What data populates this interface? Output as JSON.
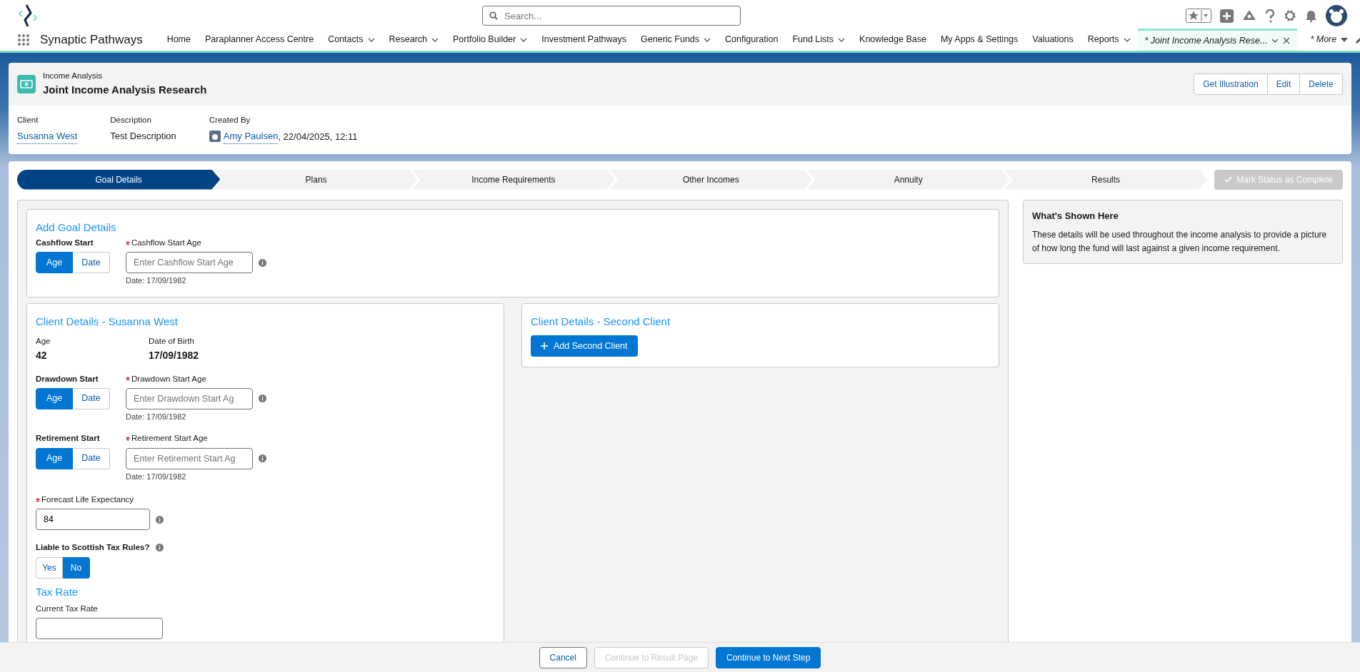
{
  "app": {
    "name": "Synaptic Pathways"
  },
  "search": {
    "placeholder": "Search..."
  },
  "nav_items": [
    {
      "label": "Home",
      "menu": false,
      "closable": false,
      "selected": false
    },
    {
      "label": "Paraplanner Access Centre",
      "menu": false,
      "closable": false,
      "selected": false
    },
    {
      "label": "Contacts",
      "menu": true,
      "closable": false,
      "selected": false
    },
    {
      "label": "Research",
      "menu": true,
      "closable": false,
      "selected": false
    },
    {
      "label": "Portfolio Builder",
      "menu": true,
      "closable": false,
      "selected": false
    },
    {
      "label": "Investment Pathways",
      "menu": false,
      "closable": false,
      "selected": false
    },
    {
      "label": "Generic Funds",
      "menu": true,
      "closable": false,
      "selected": false
    },
    {
      "label": "Configuration",
      "menu": false,
      "closable": false,
      "selected": false
    },
    {
      "label": "Fund Lists",
      "menu": true,
      "closable": false,
      "selected": false
    },
    {
      "label": "Knowledge Base",
      "menu": false,
      "closable": false,
      "selected": false
    },
    {
      "label": "My Apps & Settings",
      "menu": false,
      "closable": false,
      "selected": false
    },
    {
      "label": "Valuations",
      "menu": false,
      "closable": false,
      "selected": false
    },
    {
      "label": "Reports",
      "menu": true,
      "closable": false,
      "selected": false
    },
    {
      "label": "* Joint Income Analysis Rese...",
      "menu": true,
      "closable": true,
      "selected": true
    }
  ],
  "more": "* More",
  "record": {
    "object_type": "Income Analysis",
    "title": "Joint Income Analysis Research",
    "actions": [
      "Get Illustration",
      "Edit",
      "Delete"
    ],
    "fields": [
      {
        "label": "Client",
        "kind": "link",
        "value": "Susanna West"
      },
      {
        "label": "Description",
        "kind": "text",
        "value": "Test Description"
      },
      {
        "label": "Created By",
        "kind": "user",
        "link": "Amy Paulsen",
        "value": ", 22/04/2025, 12:11"
      }
    ]
  },
  "path": {
    "steps": [
      {
        "label": "Goal Details",
        "selected": true
      },
      {
        "label": "Plans",
        "selected": false
      },
      {
        "label": "Income Requirements",
        "selected": false
      },
      {
        "label": "Other Incomes",
        "selected": false
      },
      {
        "label": "Annuity",
        "selected": false
      },
      {
        "label": "Results",
        "selected": false
      }
    ],
    "complete_button": {
      "label": "Mark Status as Complete",
      "disabled": true
    }
  },
  "goal_section": {
    "title": "Add Goal Details",
    "toggles": [
      {
        "label": "Cashflow Start",
        "options": [
          {
            "label": "Age",
            "selected": true
          },
          {
            "label": "Date",
            "selected": false
          }
        ],
        "input_label": "Cashflow Start Age",
        "required": true,
        "placeholder": "Enter Cashflow Start Age",
        "hint": "Date: 17/09/1982"
      }
    ]
  },
  "client": {
    "title": "Client Details - Susanna West",
    "age_label": "Age",
    "age": "42",
    "dob_label": "Date of Birth",
    "dob": "17/09/1982",
    "toggles": [
      {
        "label": "Drawdown Start",
        "options": [
          {
            "label": "Age",
            "selected": true
          },
          {
            "label": "Date",
            "selected": false
          }
        ],
        "input_label": "Drawdown Start Age",
        "required": true,
        "placeholder": "Enter Drawdown Start Ag",
        "hint": "Date: 17/09/1982"
      },
      {
        "label": "Retirement Start",
        "options": [
          {
            "label": "Age",
            "selected": true
          },
          {
            "label": "Date",
            "selected": false
          }
        ],
        "input_label": "Retirement Start Age",
        "required": true,
        "placeholder": "Enter Retirement Start Ag",
        "hint": "Date: 17/09/1982"
      }
    ],
    "life_expectancy": {
      "label": "Forecast Life Expectancy",
      "required": true,
      "value": "84"
    },
    "scottish": {
      "label": "Liable to Scottish Tax Rules?",
      "options": [
        {
          "label": "Yes",
          "selected": false
        },
        {
          "label": "No",
          "selected": true
        }
      ]
    },
    "tax_title": "Tax Rate",
    "current_tax": {
      "label": "Current Tax Rate"
    }
  },
  "second_client": {
    "title": "Client Details - Second Client",
    "button": "Add Second Client"
  },
  "info": {
    "title": "What's Shown Here",
    "text": "These details will be used throughout the income analysis to provide a picture of how long the fund will last against a given income requirement."
  },
  "footer": {
    "buttons": [
      {
        "label": "Cancel",
        "kind": "neutral"
      },
      {
        "label": "Continue to Result Page",
        "kind": "disabled"
      },
      {
        "label": "Continue to Next Step",
        "kind": "brand"
      }
    ]
  }
}
